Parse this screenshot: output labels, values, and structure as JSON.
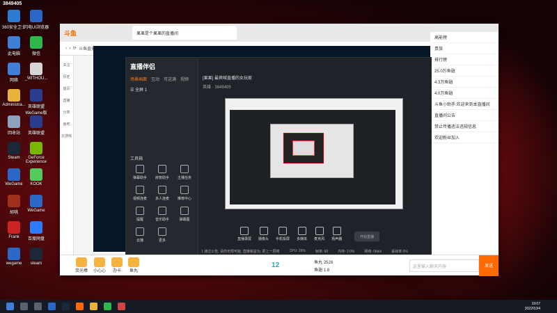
{
  "desktop": {
    "icons": [
      {
        "label": "360安全卫士",
        "color": "#2a7bd1"
      },
      {
        "label": "闪电UI浏览器",
        "color": "#2b67c7"
      },
      {
        "label": "此电脑",
        "color": "#3f7fd6"
      },
      {
        "label": "微信",
        "color": "#2eb84c"
      },
      {
        "label": "网络",
        "color": "#3f7fd6"
      },
      {
        "label": "_WITHOU...",
        "color": "#d5d5d5"
      },
      {
        "label": "Administra...",
        "color": "#e8b33a"
      },
      {
        "label": "英雄联盟WeGame版",
        "color": "#2b3d8f"
      },
      {
        "label": "回收站",
        "color": "#8da3bd"
      },
      {
        "label": "英雄联盟",
        "color": "#2b3d8f"
      },
      {
        "label": "Steam",
        "color": "#1b2838"
      },
      {
        "label": "GeForce Experience",
        "color": "#76b900"
      },
      {
        "label": "WeGame",
        "color": "#2b67c7"
      },
      {
        "label": "KOOK",
        "color": "#53ca5b"
      },
      {
        "label": "胡桃",
        "color": "#a0301e"
      },
      {
        "label": "WeGame",
        "color": "#2b67c7"
      },
      {
        "label": "Frank",
        "color": "#c22"
      },
      {
        "label": "百度网盘",
        "color": "#2d7bff"
      },
      {
        "label": "wegame",
        "color": "#2b67c7"
      },
      {
        "label": "steam",
        "color": "#1b2838"
      }
    ],
    "score_badge": "3849405"
  },
  "browser": {
    "tab_title": "果果是个果果的直播间",
    "url_hint": "斗鱼直播",
    "logo": "斗鱼",
    "sidebar_items": [
      "关注",
      "历史",
      "首页",
      "直播",
      "分类",
      "鱼吧",
      "云游戏"
    ],
    "chat_placeholder": "这里输入聊天内容",
    "send_label": "发送",
    "gifts": [
      "荧光棒",
      "小心心",
      "办卡",
      "鱼丸"
    ],
    "fans_count": "12",
    "right_panel": [
      "高能榜",
      "贵族",
      "排行榜",
      "25.0万鱼翅",
      "4.3万鱼翅",
      "4.0万鱼翅",
      "斗鱼小助手:欢迎来到本直播间",
      "直播间公告",
      "禁止传播违法违规信息",
      "欢迎粉丝加入"
    ],
    "bottom_stats": [
      "鱼丸 2528",
      "鱼翅 1.8"
    ]
  },
  "obs": {
    "logo": "直播伴侣",
    "tabs": [
      "场景画面",
      "互动",
      "可这满",
      "视频"
    ],
    "scene": "全屏 1",
    "room_title": "[果果] 最爽喊直播的女玩家",
    "category": "英雄",
    "room_id": "3849405",
    "tool_title": "工具箱",
    "tools": [
      "弹幕助手",
      "房管助手",
      "主播任务",
      "视频连麦",
      "多人连麦",
      "推荐中心",
      "提醒",
      "音乐助手",
      "弹幕图",
      "云播",
      "更多"
    ],
    "controls": [
      "直播录屏",
      "摄像头",
      "手机投屏",
      "多媒体",
      "麦克风",
      "扬声器"
    ],
    "start_label": "开始直播",
    "status": [
      "CPU: 26%",
      "帧率: 60",
      "内存: 2.0%",
      "网络: 0kb/s",
      "丢帧率 0%"
    ],
    "notice": "1 通过公告, 请你无限可能, 直播收益功, 更上一层楼"
  },
  "taskbar": {
    "time": "19:07",
    "date": "2022/10/4"
  }
}
